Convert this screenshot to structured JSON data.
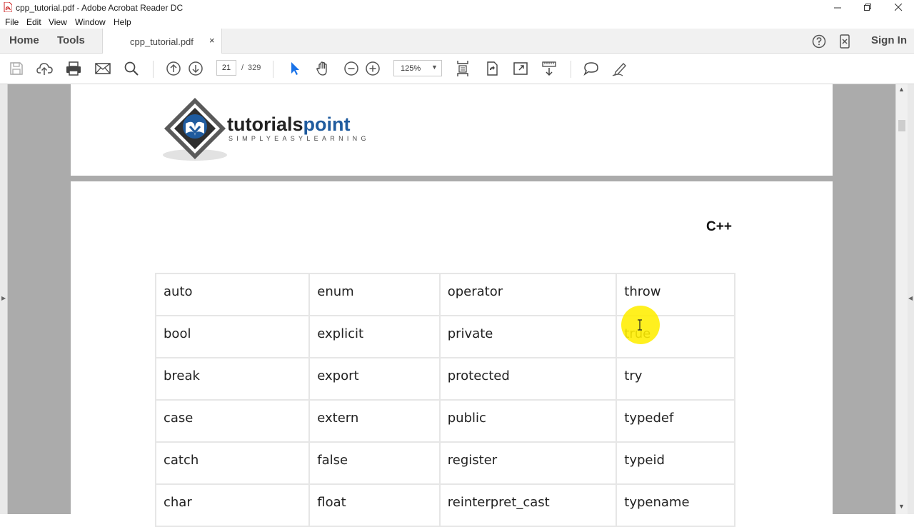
{
  "window": {
    "title": "cpp_tutorial.pdf - Adobe Acrobat Reader DC"
  },
  "menu": [
    "File",
    "Edit",
    "View",
    "Window",
    "Help"
  ],
  "tabs": {
    "home": "Home",
    "tools": "Tools",
    "document": "cpp_tutorial.pdf",
    "close_glyph": "×",
    "sign_in": "Sign In"
  },
  "toolbar": {
    "page_current": "21",
    "page_separator": "/",
    "page_total": "329",
    "zoom": "125%"
  },
  "document": {
    "logo_word": "tutorialspoint",
    "logo_word_dark": "tutorials",
    "logo_word_blue": "point",
    "logo_tagline": "SIMPLYEASYLEARNING",
    "header_right": "C++",
    "keyword_rows": [
      [
        "auto",
        "enum",
        "operator",
        "throw"
      ],
      [
        "bool",
        "explicit",
        "private",
        "true"
      ],
      [
        "break",
        "export",
        "protected",
        "try"
      ],
      [
        "case",
        "extern",
        "public",
        "typedef"
      ],
      [
        "catch",
        "false",
        "register",
        "typeid"
      ],
      [
        "char",
        "float",
        "reinterpret_cast",
        "typename"
      ]
    ]
  },
  "colors": {
    "accent": "#1f5b9e",
    "highlight": "#ffee00",
    "pointer": "#1a73e8"
  }
}
